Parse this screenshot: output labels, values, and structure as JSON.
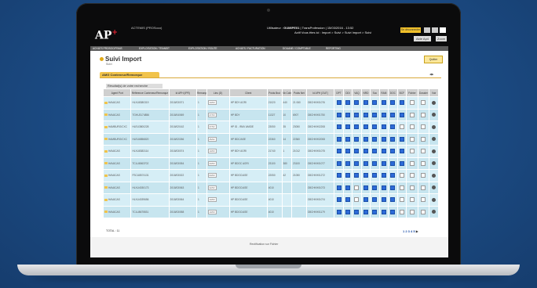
{
  "app": {
    "logo": "AP",
    "logo_sup": "+",
    "company": "ACTEMIS (PROSoco)",
    "user_label": "Utilisateur : ",
    "user_name": "GUMIPE01",
    "user_role": "TransProfession",
    "user_date": "15/03/2016 - 13:52",
    "user_red": "Actif",
    "path": "Vous êtes ici : Import > Suivi > Suivi Import > Suivi",
    "notif": "Se déconnecter",
    "aide": "Aide Ap4",
    "zoom": "Zoom"
  },
  "menu": [
    "ACHATS PROSOC/FRAIS",
    "EXPLOITATION / TRANSIT",
    "EXPLOITATION / ROUTE",
    "ACHATS / FACTURATION",
    "DOUANE / COMPTABLE",
    "REPORTING"
  ],
  "page": {
    "title": "Suivi Import",
    "subtitle": "Suivi",
    "quitter": "Quitter",
    "tab": "AMG Conteneur/Remorque",
    "results": "Résultat(s) de votre recherche",
    "total": "TOTAL : 11",
    "pages_label": "1 2 3 4 5",
    "footer": "Rectification sur Fichier"
  },
  "table": {
    "headers": [
      "Agent Port",
      "Référence Conteneur/Remorque",
      "Id APH (IPR)",
      "Remorque",
      "Lieu (D)",
      "Client",
      "Poids Brut",
      "Nb Colis",
      "Poids Net",
      "Id APH (OUT)",
      "DPT",
      "DDI",
      "VAQ",
      "NRD",
      "Soc",
      "RAM",
      "DOC",
      "BCF",
      "Fichier",
      "Dossier",
      "Voir"
    ],
    "rows": [
      [
        "HAVACAS",
        "HLXU8380319",
        "2018/03/071",
        "1",
        "FOSS",
        "HP BDY AGRI",
        "21020",
        "440",
        "21 060",
        "O8CHKH01076"
      ],
      [
        "HAVACAS",
        "TGHU3174856",
        "2018/04/069",
        "1",
        "FOSS",
        "HP BDY",
        "11327",
        "10",
        "6907",
        "O8CHKH01750"
      ],
      [
        "HAMBURG/CXC",
        "HLEU3800228",
        "2018/02/162",
        "1",
        "FOSS",
        "HP ID - IRAV AMIDE",
        "23050",
        "35",
        "23050",
        "O8CHKH02208"
      ],
      [
        "HAMBURG/CXC",
        "HLEU6856820",
        "2018/02/266",
        "1",
        "FOSS",
        "HP BDC/ASE",
        "22360",
        "14",
        "22360",
        "O8CHKH02008"
      ],
      [
        "HAVACAS",
        "HLXU8383114",
        "2018/03/074",
        "1",
        "FOSS",
        "HP BDY AGRI",
        "21740",
        "1",
        "21012",
        "O8CHKH01075"
      ],
      [
        "HAVACAS",
        "TCLU6563702",
        "2018/03/054",
        "1",
        "FOSS",
        "HP BDOC AGRI",
        "23100",
        "380",
        "23100",
        "O8CHKH01077"
      ],
      [
        "HAVACAS",
        "FSCU8574131",
        "2018/03/022",
        "1",
        "FOSS",
        "HP BDOC/ASE",
        "22050",
        "42",
        "21050",
        "O8CHKH01272"
      ],
      [
        "HAVACAS",
        "HLXU4030173",
        "2018/03/063",
        "1",
        "FOSS",
        "HP BDOC/ASE",
        "4010",
        "",
        "",
        "O8CHKH01073"
      ],
      [
        "HAVACAS",
        "HLXU4039656",
        "2018/03/064",
        "1",
        "FOSS",
        "HP BDOC/ASE",
        "4010",
        "",
        "",
        "O8CHKH01074"
      ],
      [
        "HAVACAS",
        "TCLU8675531",
        "2018/03/058",
        "1",
        "FOSS",
        "HP BDOC/ASE",
        "4010",
        "",
        "",
        "O8CHKH01179"
      ]
    ],
    "dates": [
      "13/03",
      "27/03",
      "27/02",
      "25/02",
      "13/03",
      "23/03",
      "03/03",
      "22/02",
      "13/03",
      "13/03"
    ]
  },
  "colors": {
    "accent": "#f1c34b",
    "check": "#2d6bd8",
    "row": "#d6eef6",
    "bg": "#1b4a82"
  }
}
